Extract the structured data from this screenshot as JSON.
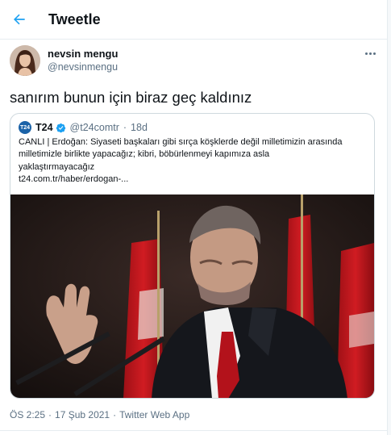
{
  "header": {
    "title": "Tweetle",
    "back_icon": "arrow-left-icon"
  },
  "author": {
    "display_name": "nevsin mengu",
    "handle": "@nevsinmengu"
  },
  "tweet": {
    "text": "sanırım bunun için biraz geç kaldınız"
  },
  "quoted": {
    "logo_text": "T24",
    "name": "T24",
    "handle": "@t24comtr",
    "separator": "·",
    "age": "18d",
    "lines": [
      "CANLI | Erdoğan: Siyaseti başkaları gibi sırça köşklerde değil milletimizin arasında",
      "milletimizle birlikte yapacağız; kibri, böbürlenmeyi kapımıza asla",
      "yaklaştırmayacağız"
    ],
    "link": "t24.com.tr/haber/erdogan-..."
  },
  "footer": {
    "time": "ÖS 2:25",
    "dot1": "·",
    "date": "17 Şub 2021",
    "dot2": "·",
    "source": "Twitter Web App"
  },
  "colors": {
    "accent": "#1da1f2",
    "verified": "#1da1f2",
    "muted": "#5b7083",
    "border": "#cfd9de"
  }
}
